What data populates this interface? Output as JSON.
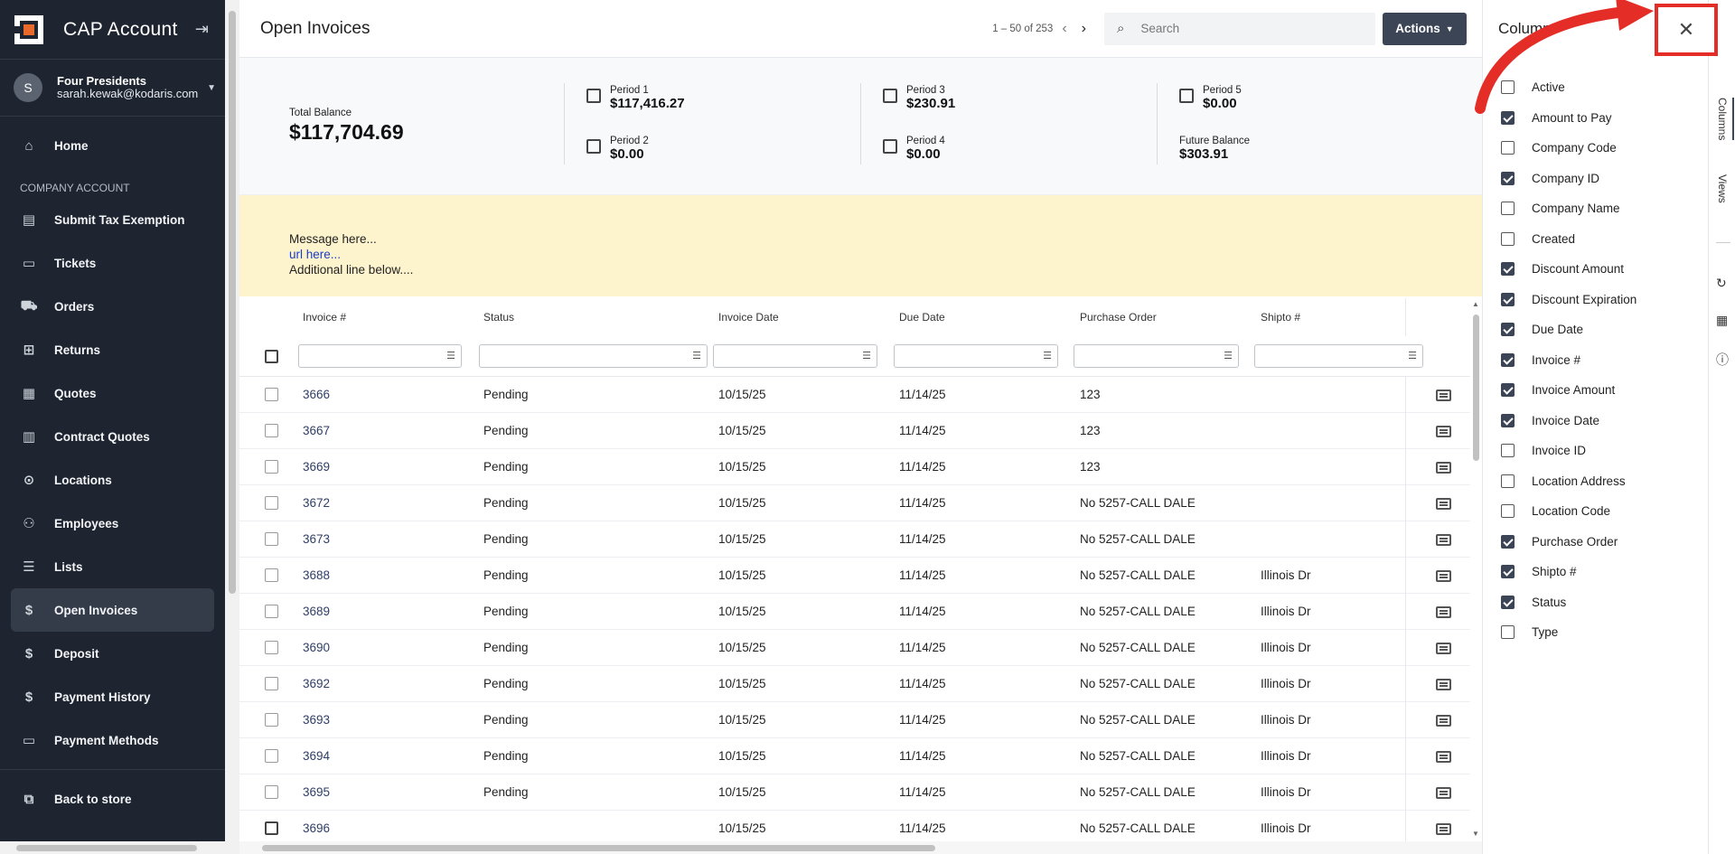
{
  "sidebar": {
    "brand": "CAP Account",
    "user": {
      "initial": "S",
      "name": "Four Presidents",
      "email": "sarah.kewak@kodaris.com"
    },
    "home": "Home",
    "section": "COMPANY ACCOUNT",
    "items": [
      {
        "label": "Submit Tax Exemption",
        "icon": "document-icon"
      },
      {
        "label": "Tickets",
        "icon": "ticket-icon"
      },
      {
        "label": "Orders",
        "icon": "truck-icon"
      },
      {
        "label": "Returns",
        "icon": "return-icon"
      },
      {
        "label": "Quotes",
        "icon": "quote-icon"
      },
      {
        "label": "Contract Quotes",
        "icon": "clipboard-icon"
      },
      {
        "label": "Locations",
        "icon": "location-icon"
      },
      {
        "label": "Employees",
        "icon": "people-icon"
      },
      {
        "label": "Lists",
        "icon": "list-icon"
      },
      {
        "label": "Open Invoices",
        "icon": "dollar-icon"
      },
      {
        "label": "Deposit",
        "icon": "dollar-icon"
      },
      {
        "label": "Payment History",
        "icon": "dollar-icon"
      },
      {
        "label": "Payment Methods",
        "icon": "card-icon"
      }
    ],
    "back": "Back to store"
  },
  "header": {
    "title": "Open Invoices",
    "pagination": "1 – 50 of 253",
    "search_placeholder": "Search",
    "actions_label": "Actions"
  },
  "balances": {
    "total_label": "Total Balance",
    "total_value": "$117,704.69",
    "periods": [
      {
        "label": "Period 1",
        "value": "$117,416.27"
      },
      {
        "label": "Period 2",
        "value": "$0.00"
      },
      {
        "label": "Period 3",
        "value": "$230.91"
      },
      {
        "label": "Period 4",
        "value": "$0.00"
      },
      {
        "label": "Period 5",
        "value": "$0.00"
      }
    ],
    "future_label": "Future Balance",
    "future_value": "$303.91"
  },
  "message": {
    "line1": "Message here...",
    "link": "url here...",
    "line2": "Additional line below...."
  },
  "table": {
    "columns": [
      "Invoice #",
      "Status",
      "Invoice Date",
      "Due Date",
      "Purchase Order",
      "Shipto #"
    ],
    "rows": [
      [
        "3666",
        "Pending",
        "10/15/25",
        "11/14/25",
        "123",
        ""
      ],
      [
        "3667",
        "Pending",
        "10/15/25",
        "11/14/25",
        "123",
        ""
      ],
      [
        "3669",
        "Pending",
        "10/15/25",
        "11/14/25",
        "123",
        ""
      ],
      [
        "3672",
        "Pending",
        "10/15/25",
        "11/14/25",
        "No 5257-CALL DALE",
        ""
      ],
      [
        "3673",
        "Pending",
        "10/15/25",
        "11/14/25",
        "No 5257-CALL DALE",
        ""
      ],
      [
        "3688",
        "Pending",
        "10/15/25",
        "11/14/25",
        "No 5257-CALL DALE",
        "Illinois Dr"
      ],
      [
        "3689",
        "Pending",
        "10/15/25",
        "11/14/25",
        "No 5257-CALL DALE",
        "Illinois Dr"
      ],
      [
        "3690",
        "Pending",
        "10/15/25",
        "11/14/25",
        "No 5257-CALL DALE",
        "Illinois Dr"
      ],
      [
        "3692",
        "Pending",
        "10/15/25",
        "11/14/25",
        "No 5257-CALL DALE",
        "Illinois Dr"
      ],
      [
        "3693",
        "Pending",
        "10/15/25",
        "11/14/25",
        "No 5257-CALL DALE",
        "Illinois Dr"
      ],
      [
        "3694",
        "Pending",
        "10/15/25",
        "11/14/25",
        "No 5257-CALL DALE",
        "Illinois Dr"
      ],
      [
        "3695",
        "Pending",
        "10/15/25",
        "11/14/25",
        "No 5257-CALL DALE",
        "Illinois Dr"
      ],
      [
        "3696",
        "",
        "10/15/25",
        "11/14/25",
        "No 5257-CALL DALE",
        "Illinois Dr"
      ]
    ]
  },
  "columns_panel": {
    "title": "Columns",
    "close_glyph": "✕",
    "items": [
      {
        "label": "Active",
        "checked": false
      },
      {
        "label": "Amount to Pay",
        "checked": true
      },
      {
        "label": "Company Code",
        "checked": false
      },
      {
        "label": "Company ID",
        "checked": true
      },
      {
        "label": "Company Name",
        "checked": false
      },
      {
        "label": "Created",
        "checked": false
      },
      {
        "label": "Discount Amount",
        "checked": true
      },
      {
        "label": "Discount Expiration",
        "checked": true
      },
      {
        "label": "Due Date",
        "checked": true
      },
      {
        "label": "Invoice #",
        "checked": true
      },
      {
        "label": "Invoice Amount",
        "checked": true
      },
      {
        "label": "Invoice Date",
        "checked": true
      },
      {
        "label": "Invoice ID",
        "checked": false
      },
      {
        "label": "Location Address",
        "checked": false
      },
      {
        "label": "Location Code",
        "checked": false
      },
      {
        "label": "Purchase Order",
        "checked": true
      },
      {
        "label": "Shipto #",
        "checked": true
      },
      {
        "label": "Status",
        "checked": true
      },
      {
        "label": "Type",
        "checked": false
      }
    ],
    "tabs": [
      "Columns",
      "Views"
    ]
  },
  "colors": {
    "sidebar_bg": "#1e2530",
    "accent": "#3b4556",
    "annotation": "#e52d27",
    "message_bg": "#fdf3cd"
  }
}
